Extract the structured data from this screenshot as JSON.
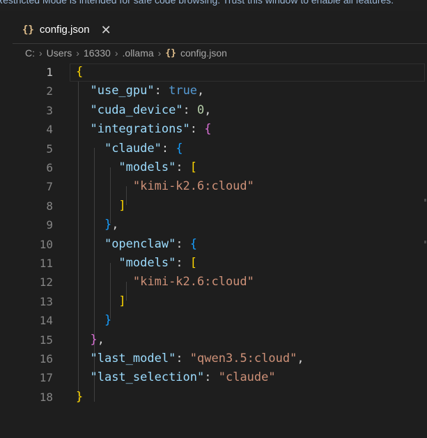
{
  "banner": {
    "text": "Restricted Mode is intended for safe code browsing. Trust this window to enable all features."
  },
  "tab": {
    "icon": "{}",
    "label": "config.json",
    "close": "✕"
  },
  "breadcrumb": {
    "parts": [
      "C:",
      "Users",
      "16330",
      ".ollama"
    ],
    "file_icon": "{}",
    "file": "config.json",
    "separator": "›"
  },
  "editor": {
    "lines": [
      {
        "num": "1",
        "tokens": [
          [
            "br1",
            "{"
          ]
        ]
      },
      {
        "num": "2",
        "tokens": [
          [
            "p",
            "  "
          ],
          [
            "k",
            "\"use_gpu\""
          ],
          [
            "p",
            ": "
          ],
          [
            "b",
            "true"
          ],
          [
            "p",
            ","
          ]
        ]
      },
      {
        "num": "3",
        "tokens": [
          [
            "p",
            "  "
          ],
          [
            "k",
            "\"cuda_device\""
          ],
          [
            "p",
            ": "
          ],
          [
            "n",
            "0"
          ],
          [
            "p",
            ","
          ]
        ]
      },
      {
        "num": "4",
        "tokens": [
          [
            "p",
            "  "
          ],
          [
            "k",
            "\"integrations\""
          ],
          [
            "p",
            ": "
          ],
          [
            "br2",
            "{"
          ]
        ]
      },
      {
        "num": "5",
        "tokens": [
          [
            "p",
            "    "
          ],
          [
            "k",
            "\"claude\""
          ],
          [
            "p",
            ": "
          ],
          [
            "br3",
            "{"
          ]
        ]
      },
      {
        "num": "6",
        "tokens": [
          [
            "p",
            "      "
          ],
          [
            "k",
            "\"models\""
          ],
          [
            "p",
            ": "
          ],
          [
            "br1",
            "["
          ]
        ]
      },
      {
        "num": "7",
        "tokens": [
          [
            "p",
            "        "
          ],
          [
            "s",
            "\"kimi-k2.6:cloud\""
          ]
        ]
      },
      {
        "num": "8",
        "tokens": [
          [
            "p",
            "      "
          ],
          [
            "br1",
            "]"
          ]
        ]
      },
      {
        "num": "9",
        "tokens": [
          [
            "p",
            "    "
          ],
          [
            "br3",
            "}"
          ],
          [
            "p",
            ","
          ]
        ]
      },
      {
        "num": "10",
        "tokens": [
          [
            "p",
            "    "
          ],
          [
            "k",
            "\"openclaw\""
          ],
          [
            "p",
            ": "
          ],
          [
            "br3",
            "{"
          ]
        ]
      },
      {
        "num": "11",
        "tokens": [
          [
            "p",
            "      "
          ],
          [
            "k",
            "\"models\""
          ],
          [
            "p",
            ": "
          ],
          [
            "br1",
            "["
          ]
        ]
      },
      {
        "num": "12",
        "tokens": [
          [
            "p",
            "        "
          ],
          [
            "s",
            "\"kimi-k2.6:cloud\""
          ]
        ]
      },
      {
        "num": "13",
        "tokens": [
          [
            "p",
            "      "
          ],
          [
            "br1",
            "]"
          ]
        ]
      },
      {
        "num": "14",
        "tokens": [
          [
            "p",
            "    "
          ],
          [
            "br3",
            "}"
          ]
        ]
      },
      {
        "num": "15",
        "tokens": [
          [
            "p",
            "  "
          ],
          [
            "br2",
            "}"
          ],
          [
            "p",
            ","
          ]
        ]
      },
      {
        "num": "16",
        "tokens": [
          [
            "p",
            "  "
          ],
          [
            "k",
            "\"last_model\""
          ],
          [
            "p",
            ": "
          ],
          [
            "s",
            "\"qwen3.5:cloud\""
          ],
          [
            "p",
            ","
          ]
        ]
      },
      {
        "num": "17",
        "tokens": [
          [
            "p",
            "  "
          ],
          [
            "k",
            "\"last_selection\""
          ],
          [
            "p",
            ": "
          ],
          [
            "s",
            "\"claude\""
          ]
        ]
      },
      {
        "num": "18",
        "tokens": [
          [
            "br1",
            "}"
          ]
        ]
      }
    ]
  }
}
